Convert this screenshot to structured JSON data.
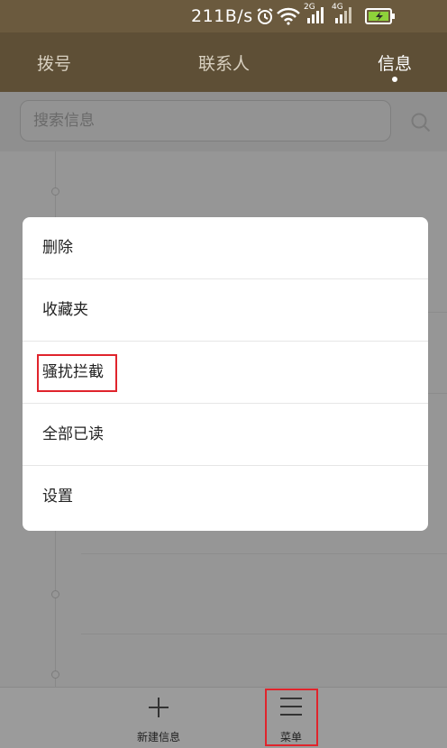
{
  "status_bar": {
    "net_speed": "211B/s",
    "icons": [
      "alarm-icon",
      "wifi-icon",
      "signal-2g-icon",
      "signal-4g-icon",
      "battery-charging-icon"
    ],
    "sim1_label": "2G",
    "sim2_label": "4G"
  },
  "tabs": [
    {
      "label": "拨号"
    },
    {
      "label": "联系人"
    },
    {
      "label": "信息"
    }
  ],
  "active_tab": "信息",
  "search": {
    "placeholder": "搜索信息"
  },
  "menu": {
    "items": [
      {
        "label": "删除"
      },
      {
        "label": "收藏夹"
      },
      {
        "label": "骚扰拦截"
      },
      {
        "label": "全部已读"
      },
      {
        "label": "设置"
      }
    ]
  },
  "bottom_bar": {
    "new_message_label": "新建信息",
    "menu_label": "菜单"
  },
  "colors": {
    "header_brown": "#5e4f36",
    "highlight_red": "#e0242c",
    "menu_bg": "#ffffff"
  }
}
